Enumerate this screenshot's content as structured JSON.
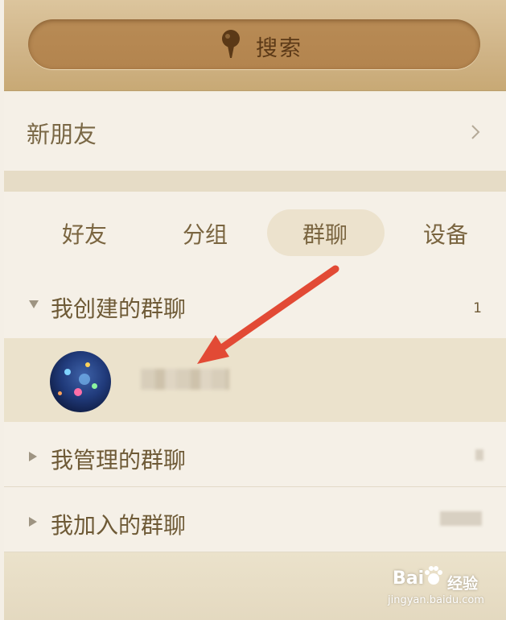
{
  "search": {
    "label": "搜索"
  },
  "new_friends": {
    "label": "新朋友"
  },
  "tabs": [
    {
      "label": "好友",
      "active": false
    },
    {
      "label": "分组",
      "active": false
    },
    {
      "label": "群聊",
      "active": true
    },
    {
      "label": "设备",
      "active": false
    }
  ],
  "groups": {
    "created": {
      "label": "我创建的群聊",
      "count": "1",
      "expanded": true
    },
    "managed": {
      "label": "我管理的群聊",
      "expanded": false
    },
    "joined": {
      "label": "我加入的群聊",
      "expanded": false
    }
  },
  "watermark": {
    "brand": "Bai",
    "suffix": "经验",
    "site": "jingyan.baidu.com"
  },
  "colors": {
    "accent_arrow": "#e24a35",
    "tab_active_bg": "#ece2cd",
    "search_pill": "#b3844e"
  }
}
